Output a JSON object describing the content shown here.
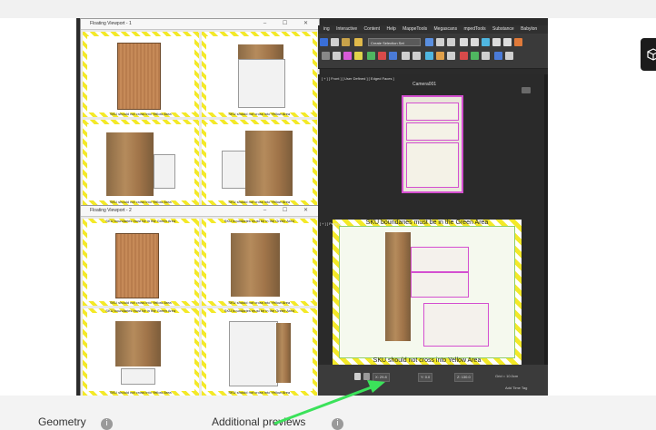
{
  "floating_viewport_1": {
    "title": "Floating Viewport - 1",
    "tiles": [
      {
        "caption_top": "SKU boundaries must be in the Green Area",
        "caption": "SKU should not cross into Yellow Area"
      },
      {
        "caption_top": "SKU boundaries must be in the Green Area",
        "caption": "SKU should not cross into Yellow Area"
      },
      {
        "caption_top": "",
        "caption": "SKU should not cross into Yellow Area"
      },
      {
        "caption_top": "",
        "caption": "SKU should not cross into Yellow Area"
      }
    ]
  },
  "floating_viewport_2": {
    "title": "Floating Viewport - 2",
    "tiles": [
      {
        "caption_top": "SKU boundaries must be in the Green Area",
        "caption": "SKU should not cross into Yellow Area"
      },
      {
        "caption_top": "SKU boundaries must be in the Green Area",
        "caption": "SKU should not cross into Yellow Area"
      },
      {
        "caption_top": "SKU boundaries must be in the Green Area",
        "caption": "SKU should not cross into Yellow Area"
      },
      {
        "caption_top": "SKU boundaries must be in the Green Area",
        "caption": "SKU should not cross into Yellow Area"
      }
    ]
  },
  "menubar": [
    "ing",
    "Interactive",
    "Content",
    "Help",
    "MappeTools",
    "Megascans",
    "mpedTools",
    "Substance",
    "Babylon"
  ],
  "toolbar": {
    "selection_set": "Create Selection Set"
  },
  "top_viewport": {
    "label": "[ + ] [ Front ] [ User Defined ] [ Edged Faces ]",
    "title": "Camera001"
  },
  "big_viewport": {
    "label": "[ + ] [ Persp ]",
    "top_text": "SKU boundaries must be in the Green Area",
    "bottom_text": "SKU should not cross into Yellow Area"
  },
  "statusbar": {
    "x_label": "X:",
    "x_value": "29.8",
    "y_label": "Y:",
    "y_value": "0.0",
    "z_label": "Z:",
    "z_value": "130.0",
    "grid_text": "Grid = 10.0cm",
    "time_tag": "Add Time Tag"
  },
  "bottom_tabs": [
    {
      "label": "Geometry"
    },
    {
      "label": "Additional previews"
    }
  ],
  "colors": {
    "accent_green": "#3be25a",
    "highlight_magenta": "#d44fd0",
    "warning_yellow": "#f3e928"
  },
  "icons": [
    "box-icon",
    "info-icon",
    "arrow-annotation"
  ]
}
